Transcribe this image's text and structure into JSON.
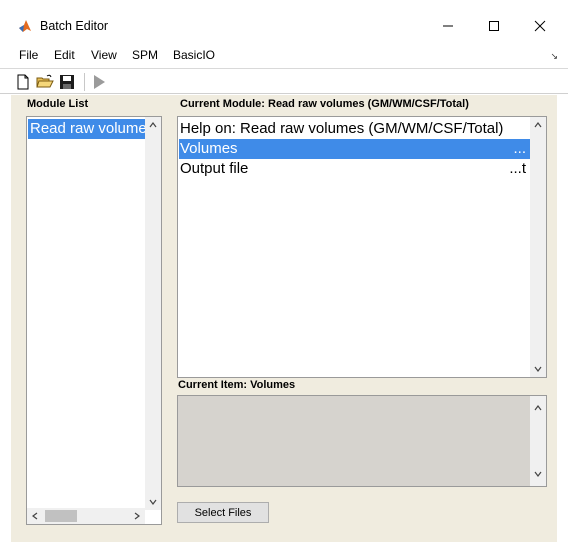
{
  "window": {
    "title": "Batch Editor",
    "controls": {
      "minimize": "—",
      "maximize": "☐",
      "close": "✕"
    }
  },
  "menubar": {
    "items": [
      "File",
      "Edit",
      "View",
      "SPM",
      "BasicIO"
    ],
    "overflow_glyph": "↘"
  },
  "toolbar": {
    "buttons": [
      "new-icon",
      "open-icon",
      "save-icon",
      "run-icon"
    ]
  },
  "module_list": {
    "label": "Module List",
    "items": [
      "Read raw volumes (GM/WM/CSF/Total)"
    ]
  },
  "current_module": {
    "label": "Current Module: Read raw volumes (GM/WM/CSF/Total)",
    "rows": [
      {
        "text": "Help on: Read raw volumes (GM/WM/CSF/Total)",
        "value": ""
      },
      {
        "text": "Volumes",
        "value": "..."
      },
      {
        "text": "Output file",
        "value": "...t"
      }
    ]
  },
  "current_item": {
    "label": "Current Item: Volumes"
  },
  "select_files_button": "Select Files",
  "colors": {
    "selection": "#3f8be8",
    "panel_bg": "#f0ecdf",
    "info_bg": "#d6d3ce"
  }
}
